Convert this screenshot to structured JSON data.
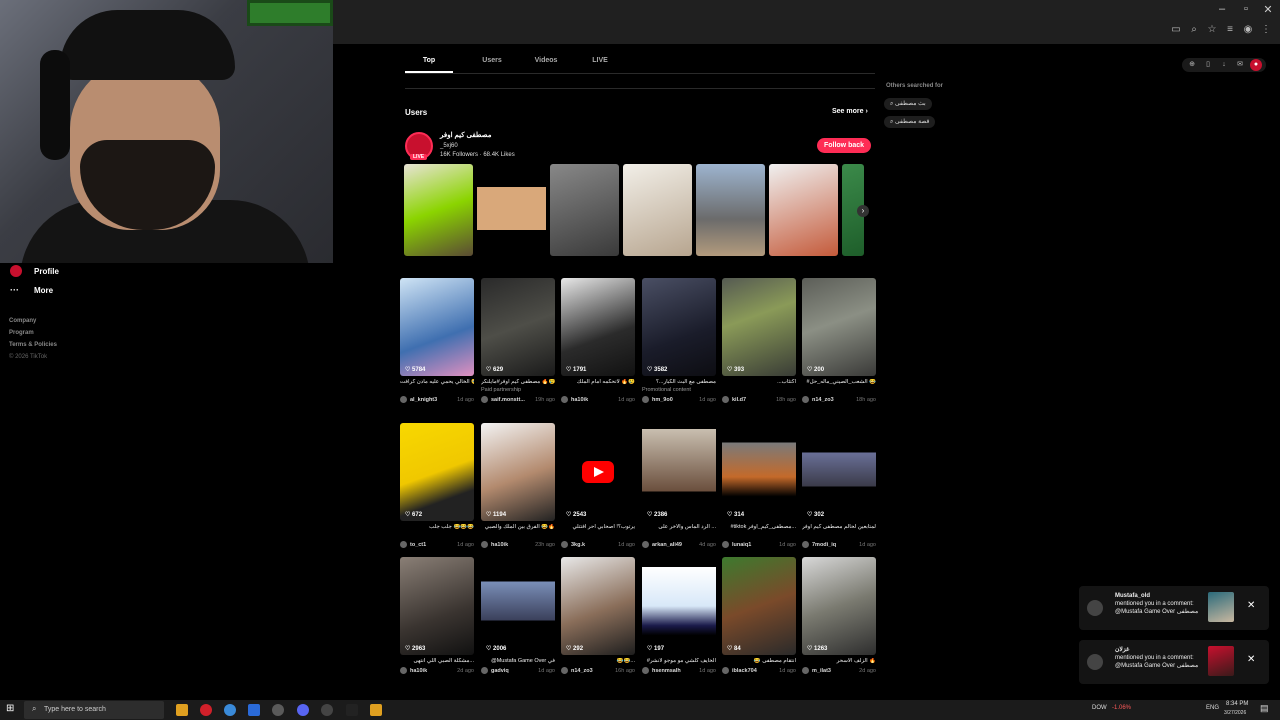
{
  "app": {
    "title": "TikTok"
  },
  "sidebar": {
    "items": [
      {
        "label": "Profile"
      },
      {
        "label": "More"
      }
    ],
    "links": [
      "Company",
      "Program",
      "Terms & Policies"
    ],
    "copyright": "© 2026 TikTok"
  },
  "tabs": [
    {
      "label": "Top",
      "active": true
    },
    {
      "label": "Users",
      "active": false
    },
    {
      "label": "Videos",
      "active": false
    },
    {
      "label": "LIVE",
      "active": false
    }
  ],
  "users": {
    "heading": "Users",
    "see_more": "See more",
    "card": {
      "name": "مصطفى كيم اوفر",
      "handle": "_5xj60",
      "stats": "16K Followers · 68.4K Likes",
      "live": "LIVE",
      "follow_label": "Follow back"
    }
  },
  "others_searched": {
    "heading": "Others searched for",
    "items": [
      "بث مصطفى",
      "قصة مصطفى"
    ]
  },
  "videos": [
    {
      "likes": "5784",
      "caption": "الخالي يحمي عليه مادن كرافت 🥹🥹",
      "sub": "",
      "author": "al_knight3",
      "ago": "1d ago"
    },
    {
      "likes": "629",
      "caption": "مصطفى كيم اوفر#مايلنكر 🔥😢...",
      "sub": "Paid partnership",
      "author": "saif.monstt...",
      "ago": "19h ago"
    },
    {
      "likes": "1791",
      "caption": "لاتحكمه امام الملك 🔥😢",
      "sub": "",
      "author": "ha10ik",
      "ago": "1d ago"
    },
    {
      "likes": "3582",
      "caption": "مصطفى مع البث الكبار...؟",
      "sub": "Promotional content",
      "author": "hm_9o0",
      "ago": "1d ago"
    },
    {
      "likes": "393",
      "caption": "...اكتئاب",
      "sub": "",
      "author": "kil.d7",
      "ago": "18h ago"
    },
    {
      "likes": "200",
      "caption": "#الشعب_الصيني_ماله_حل 😂",
      "sub": "",
      "author": "n14_zo3",
      "ago": "18h ago"
    },
    {
      "likes": "672",
      "caption": "جلب جلب 😂😂😂",
      "sub": "",
      "author": "to_ct1",
      "ago": "1d ago"
    },
    {
      "likes": "1194",
      "caption": "الفرق بين الملك والصبي 😂🔥",
      "sub": "",
      "author": "ha10ik",
      "ago": "23h ago"
    },
    {
      "likes": "2543",
      "caption": "يرتوب؟! اصحابي احر افتتلي",
      "sub": "",
      "author": "3kg.k",
      "ago": "1d ago"
    },
    {
      "likes": "2386",
      "caption": "الرد الماس والاخر على ...",
      "sub": "",
      "author": "arkan_ali49",
      "ago": "4d ago"
    },
    {
      "likes": "314",
      "caption": "#tiktok مصطفى_كيم_اوفر...",
      "sub": "",
      "author": "lunaiq1",
      "ago": "1d ago"
    },
    {
      "likes": "302",
      "caption": "المتابعين لحالم مصطفى كيم اوفر...",
      "sub": "",
      "author": "7modi_iq",
      "ago": "1d ago"
    },
    {
      "likes": "2963",
      "caption": "مشكلة الصبي اللي انتهى...",
      "sub": "",
      "author": "ha10ik",
      "ago": "2d ago"
    },
    {
      "likes": "2006",
      "caption": "@Mustafa Game Over في",
      "sub": "",
      "author": "gadviq",
      "ago": "1d ago"
    },
    {
      "likes": "292",
      "caption": "😂😂...",
      "sub": "",
      "author": "n14_zo3",
      "ago": "16h ago"
    },
    {
      "likes": "197",
      "caption": "#الخايف كلشي مو موجو لانشر",
      "sub": "",
      "author": "hsenmsalh",
      "ago": "1d ago"
    },
    {
      "likes": "84",
      "caption": "😂 انتقام مصطفى",
      "sub": "",
      "author": "iblack704",
      "ago": "1d ago"
    },
    {
      "likes": "1263",
      "caption": "الزلف الاسحر 🔥",
      "sub": "",
      "author": "m_ilat3",
      "ago": "2d ago"
    }
  ],
  "notifications": [
    {
      "user": "Mustafa_old",
      "text": "mentioned you in a comment: @Mustafa Game Over مصطفى"
    },
    {
      "user": "غزلان",
      "text": "mentioned you in a comment: @Mustafa Game Over مصطفى"
    }
  ],
  "taskbar": {
    "search_placeholder": "Type here to search",
    "ticker": "DOW",
    "ticker_change": "-1.06%",
    "lang": "ENG",
    "time": "8:34 PM",
    "date": "3/27/2026"
  },
  "colors": {
    "accent": "#fe2c55",
    "bg": "#000000"
  }
}
